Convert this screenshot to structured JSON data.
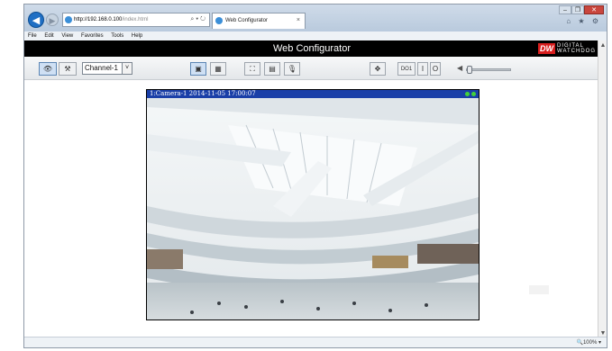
{
  "browser": {
    "address_host": "http://192.168.0.100",
    "address_path": "/index.html",
    "address_tools": "⌕ ▾ ↻",
    "tab_title": "Web Configurator",
    "tab_close": "×",
    "window_controls": [
      "‒",
      "❐",
      "✕"
    ],
    "toolbar_icons": "⌂ ★ ⚙",
    "menu": [
      "File",
      "Edit",
      "View",
      "Favorites",
      "Tools",
      "Help"
    ],
    "zoom_level": "100%",
    "zoom_label": "🔍100%  ▾"
  },
  "app": {
    "title": "Web Configurator",
    "logo_mark": "DW",
    "logo_text_1": "DIGITAL",
    "logo_text_2": "WATCHDOG"
  },
  "toolbar": {
    "live_icon": "👁",
    "setup_icon": "⚒",
    "channel_selected": "Channel-1",
    "dropdown_arrow": "˅",
    "view_single": "▣",
    "view_multi": "▦",
    "fullscreen": "⛶",
    "snapshot": "▤",
    "mic": "🎙",
    "ptz": "✥",
    "do_label": "DO1",
    "do_on": "I",
    "do_off": "O",
    "speaker": "◀",
    "volume_level": 0.0
  },
  "video": {
    "overlay_label": "1:Camera-1  2014-11-05 17:00:07",
    "status_led_color": "#43d03a"
  },
  "colors": {
    "header_bg": "#000000",
    "overlay_bar": "#1a3fa8",
    "brand_red": "#d81e1e"
  }
}
